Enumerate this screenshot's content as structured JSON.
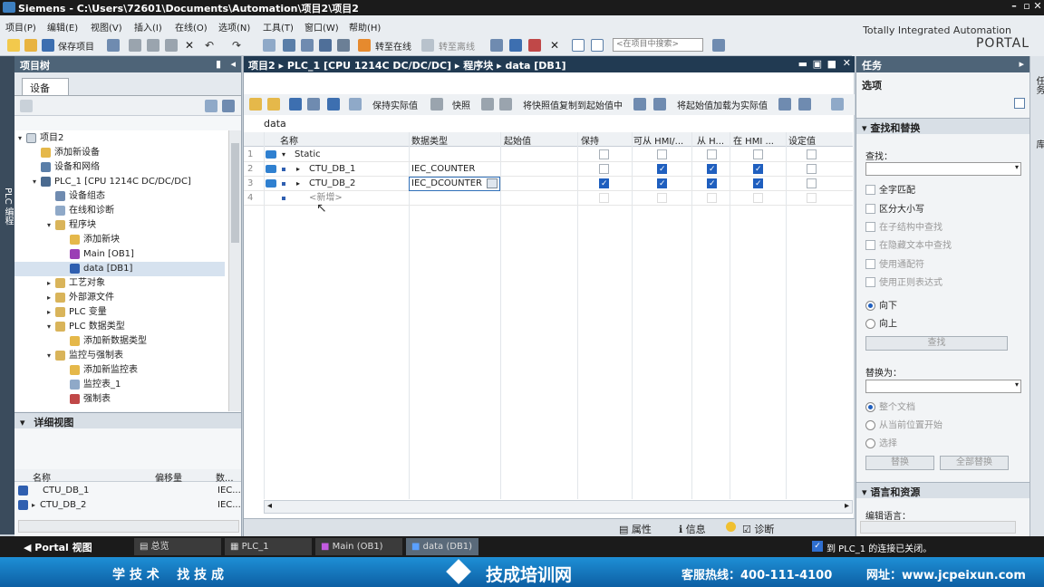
{
  "titlebar": {
    "app": "Siemens",
    "sep": "-",
    "path": "C:\\Users\\72601\\Documents\\Automation\\项目2\\项目2"
  },
  "menu": [
    "项目(P)",
    "编辑(E)",
    "视图(V)",
    "插入(I)",
    "在线(O)",
    "选项(N)",
    "工具(T)",
    "窗口(W)",
    "帮助(H)"
  ],
  "brand": {
    "line1": "Totally Integrated Automation",
    "line2": "PORTAL"
  },
  "toolbar": {
    "save_project": "保存项目",
    "go_online": "转至在线",
    "go_offline": "转至离线",
    "search_placeholder": "<在项目中搜索>"
  },
  "left_strip": "PLC 编程",
  "project_tree": {
    "title": "项目树",
    "tab": "设备",
    "items": [
      {
        "label": "项目2"
      },
      {
        "label": "添加新设备"
      },
      {
        "label": "设备和网络"
      },
      {
        "label": "PLC_1 [CPU 1214C DC/DC/DC]"
      },
      {
        "label": "设备组态"
      },
      {
        "label": "在线和诊断"
      },
      {
        "label": "程序块"
      },
      {
        "label": "添加新块"
      },
      {
        "label": "Main [OB1]"
      },
      {
        "label": "data [DB1]"
      },
      {
        "label": "工艺对象"
      },
      {
        "label": "外部源文件"
      },
      {
        "label": "PLC 变量"
      },
      {
        "label": "PLC 数据类型"
      },
      {
        "label": "添加新数据类型"
      },
      {
        "label": "监控与强制表"
      },
      {
        "label": "添加新监控表"
      },
      {
        "label": "监控表_1"
      },
      {
        "label": "强制表"
      }
    ]
  },
  "detail_view": {
    "title": "详细视图",
    "headers": [
      "名称",
      "偏移量",
      "数..."
    ],
    "rows": [
      {
        "name": "CTU_DB_1",
        "type": "IEC..."
      },
      {
        "name": "CTU_DB_2",
        "type": "IEC..."
      }
    ]
  },
  "editor": {
    "breadcrumb": [
      "项目2",
      "PLC_1 [CPU 1214C DC/DC/DC]",
      "程序块",
      "data [DB1]"
    ],
    "toolbar": {
      "keep_actual": "保持实际值",
      "snapshot": "快照",
      "copy_snapshot": "将快照值复制到起始值中",
      "load_start": "将起始值加载为实际值"
    },
    "block_name": "data",
    "headers": [
      "名称",
      "数据类型",
      "起始值",
      "保持",
      "可从 HMI/...",
      "从 H...",
      "在 HMI ...",
      "设定值"
    ],
    "rows": [
      {
        "num": "1",
        "name": "Static",
        "type": "",
        "keep": false,
        "hmi": false,
        "fromh": false,
        "inhmi": false,
        "setp": false
      },
      {
        "num": "2",
        "name": "CTU_DB_1",
        "type": "IEC_COUNTER",
        "keep": false,
        "hmi": true,
        "fromh": true,
        "inhmi": true,
        "setp": false
      },
      {
        "num": "3",
        "name": "CTU_DB_2",
        "type": "IEC_DCOUNTER",
        "keep": true,
        "hmi": true,
        "fromh": true,
        "inhmi": true,
        "setp": false
      },
      {
        "num": "4",
        "name": "<新增>",
        "type": "",
        "keep": false,
        "hmi": false,
        "fromh": false,
        "inhmi": false,
        "setp": false
      }
    ],
    "bottom_tabs": [
      "属性",
      "信息",
      "诊断"
    ]
  },
  "tasks": {
    "title": "任务",
    "options": "选项",
    "find_replace": "查找和替换",
    "find_label": "查找：",
    "checks": [
      "全字匹配",
      "区分大小写",
      "在子结构中查找",
      "在隐藏文本中查找",
      "使用通配符",
      "使用正则表达式"
    ],
    "dir_down": "向下",
    "dir_up": "向上",
    "find_btn": "查找",
    "replace_label": "替换为：",
    "scope": [
      "整个文档",
      "从当前位置开始",
      "选择"
    ],
    "replace_btn": "替换",
    "replace_all_btn": "全部替换",
    "lang_section": "语言和资源",
    "edit_lang": "编辑语言："
  },
  "right_strip": [
    "任务",
    "库"
  ],
  "taskbar": {
    "portal_view": "Portal 视图",
    "items": [
      "总览",
      "PLC_1",
      "Main (OB1)",
      "data (DB1)"
    ],
    "status": "到 PLC_1 的连接已关闭。"
  },
  "banner": {
    "slogan": "学 技 术    找 技 成",
    "brand": "技成培训网",
    "hotline": "客服热线：400-111-4100",
    "site": "网址：www.jcpeixun.com"
  }
}
